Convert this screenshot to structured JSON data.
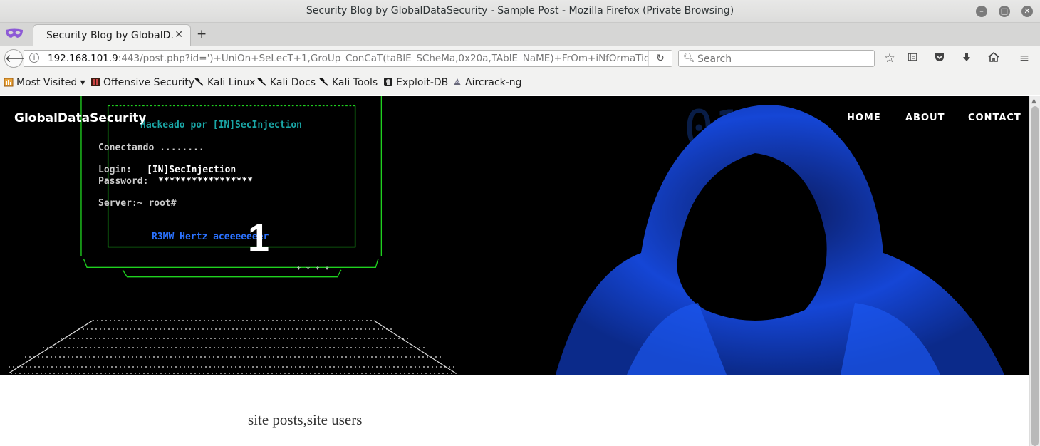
{
  "window": {
    "title": "Security Blog by GlobalDataSecurity - Sample Post - Mozilla Firefox (Private Browsing)",
    "minimize_icon": "minimize-icon",
    "maximize_icon": "maximize-icon",
    "close_icon": "close-icon"
  },
  "tabs": {
    "active_label": "Security Blog by GlobalD…",
    "close_symbol": "✕",
    "new_tab_symbol": "+"
  },
  "navbar": {
    "url_host": "192.168.101.9",
    "url_rest": ":443/post.php?id=')+UniOn+SeLecT+1,GroUp_ConCaT(taBlE_SCheMa,0x20a,TAblE_NaME)+FrOm+iNfOrmaTioN.",
    "search_placeholder": "Search"
  },
  "bookmarks": [
    {
      "label": "Most Visited ▾",
      "icon": "most-visited-icon"
    },
    {
      "label": "Offensive Security",
      "icon": "offsec-icon"
    },
    {
      "label": "Kali Linux",
      "icon": "kali-icon"
    },
    {
      "label": "Kali Docs",
      "icon": "kali-icon"
    },
    {
      "label": "Kali Tools",
      "icon": "kali-icon"
    },
    {
      "label": "Exploit-DB",
      "icon": "exploitdb-icon"
    },
    {
      "label": "Aircrack-ng",
      "icon": "aircrack-icon"
    }
  ],
  "site": {
    "brand": "GlobalDataSecurity",
    "nav": [
      "HOME",
      "ABOUT",
      "CONTACT"
    ],
    "hero_number": "1",
    "result_text": "site posts,site users"
  },
  "hero_art": {
    "line1": "Hackeado por [IN]SecInjection",
    "line2": "Conectando ........",
    "login_label": "Login:",
    "login_value": "[IN]SecInjection",
    "password_label": "Password:",
    "password_value": "*****************",
    "server": "Server:~ root#",
    "footer": "R3MW Hertz aceeeeeeer",
    "dots": "* * * *"
  },
  "colors": {
    "terminal_green": "#1fd11f",
    "terminal_cyan": "#1aa6a6",
    "terminal_blue": "#2b72ff",
    "hood_blue": "#1546d6"
  }
}
